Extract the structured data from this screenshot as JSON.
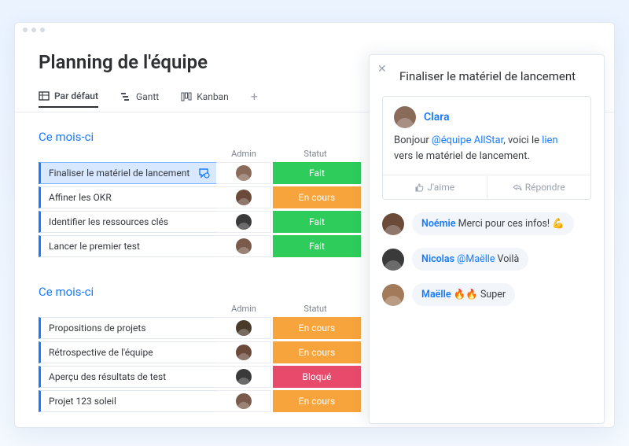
{
  "page": {
    "title": "Planning de l'équipe"
  },
  "views": {
    "tabs": [
      {
        "label": "Par défaut",
        "icon": "table-icon"
      },
      {
        "label": "Gantt",
        "icon": "gantt-icon"
      },
      {
        "label": "Kanban",
        "icon": "kanban-icon"
      }
    ]
  },
  "columns": {
    "admin": "Admin",
    "status": "Statut"
  },
  "sections": [
    {
      "title": "Ce mois-ci",
      "rows": [
        {
          "task": "Finaliser le matériel de lancement",
          "status": "Fait",
          "status_kind": "done",
          "selected": true,
          "chat": true,
          "avatar": "#8a6b5a"
        },
        {
          "task": "Affiner les OKR",
          "status": "En cours",
          "status_kind": "prog",
          "avatar": "#6b4a3a"
        },
        {
          "task": "Identifier les ressources clés",
          "status": "Fait",
          "status_kind": "done",
          "avatar": "#3a3a3a"
        },
        {
          "task": "Lancer le premier test",
          "status": "Fait",
          "status_kind": "done",
          "avatar": "#7a5a4a"
        }
      ]
    },
    {
      "title": "Ce mois-ci",
      "rows": [
        {
          "task": "Propositions de projets",
          "status": "En cours",
          "status_kind": "prog",
          "avatar": "#4a3a2a"
        },
        {
          "task": "Rétrospective de l'équipe",
          "status": "En cours",
          "status_kind": "prog",
          "avatar": "#6b4a3a"
        },
        {
          "task": "Aperçu des résultats de test",
          "status": "Bloqué",
          "status_kind": "block",
          "avatar": "#3a3a3a"
        },
        {
          "task": "Projet 123 soleil",
          "status": "En cours",
          "status_kind": "prog",
          "avatar": "#7a5a4a"
        }
      ]
    }
  ],
  "panel": {
    "title": "Finaliser le matériel de lancement",
    "main_comment": {
      "user": "Clara",
      "body_pre": "Bonjour ",
      "mention": "@équipe AllStar",
      "body_mid": ", voici le ",
      "link": "lien",
      "body_post": " vers le matériel de lancement."
    },
    "actions": {
      "like": "J'aime",
      "reply": "Répondre"
    },
    "replies": [
      {
        "user": "Noémie",
        "text": " Merci pour ces infos! 💪",
        "avatar": "#6b4a3a"
      },
      {
        "user": "Nicolas",
        "mention": " @Maëlle",
        "text": " Voilà",
        "avatar": "#3a3a3a"
      },
      {
        "user": "Maëlle",
        "text": " 🔥🔥 Super",
        "avatar": "#a37a5a"
      }
    ]
  }
}
